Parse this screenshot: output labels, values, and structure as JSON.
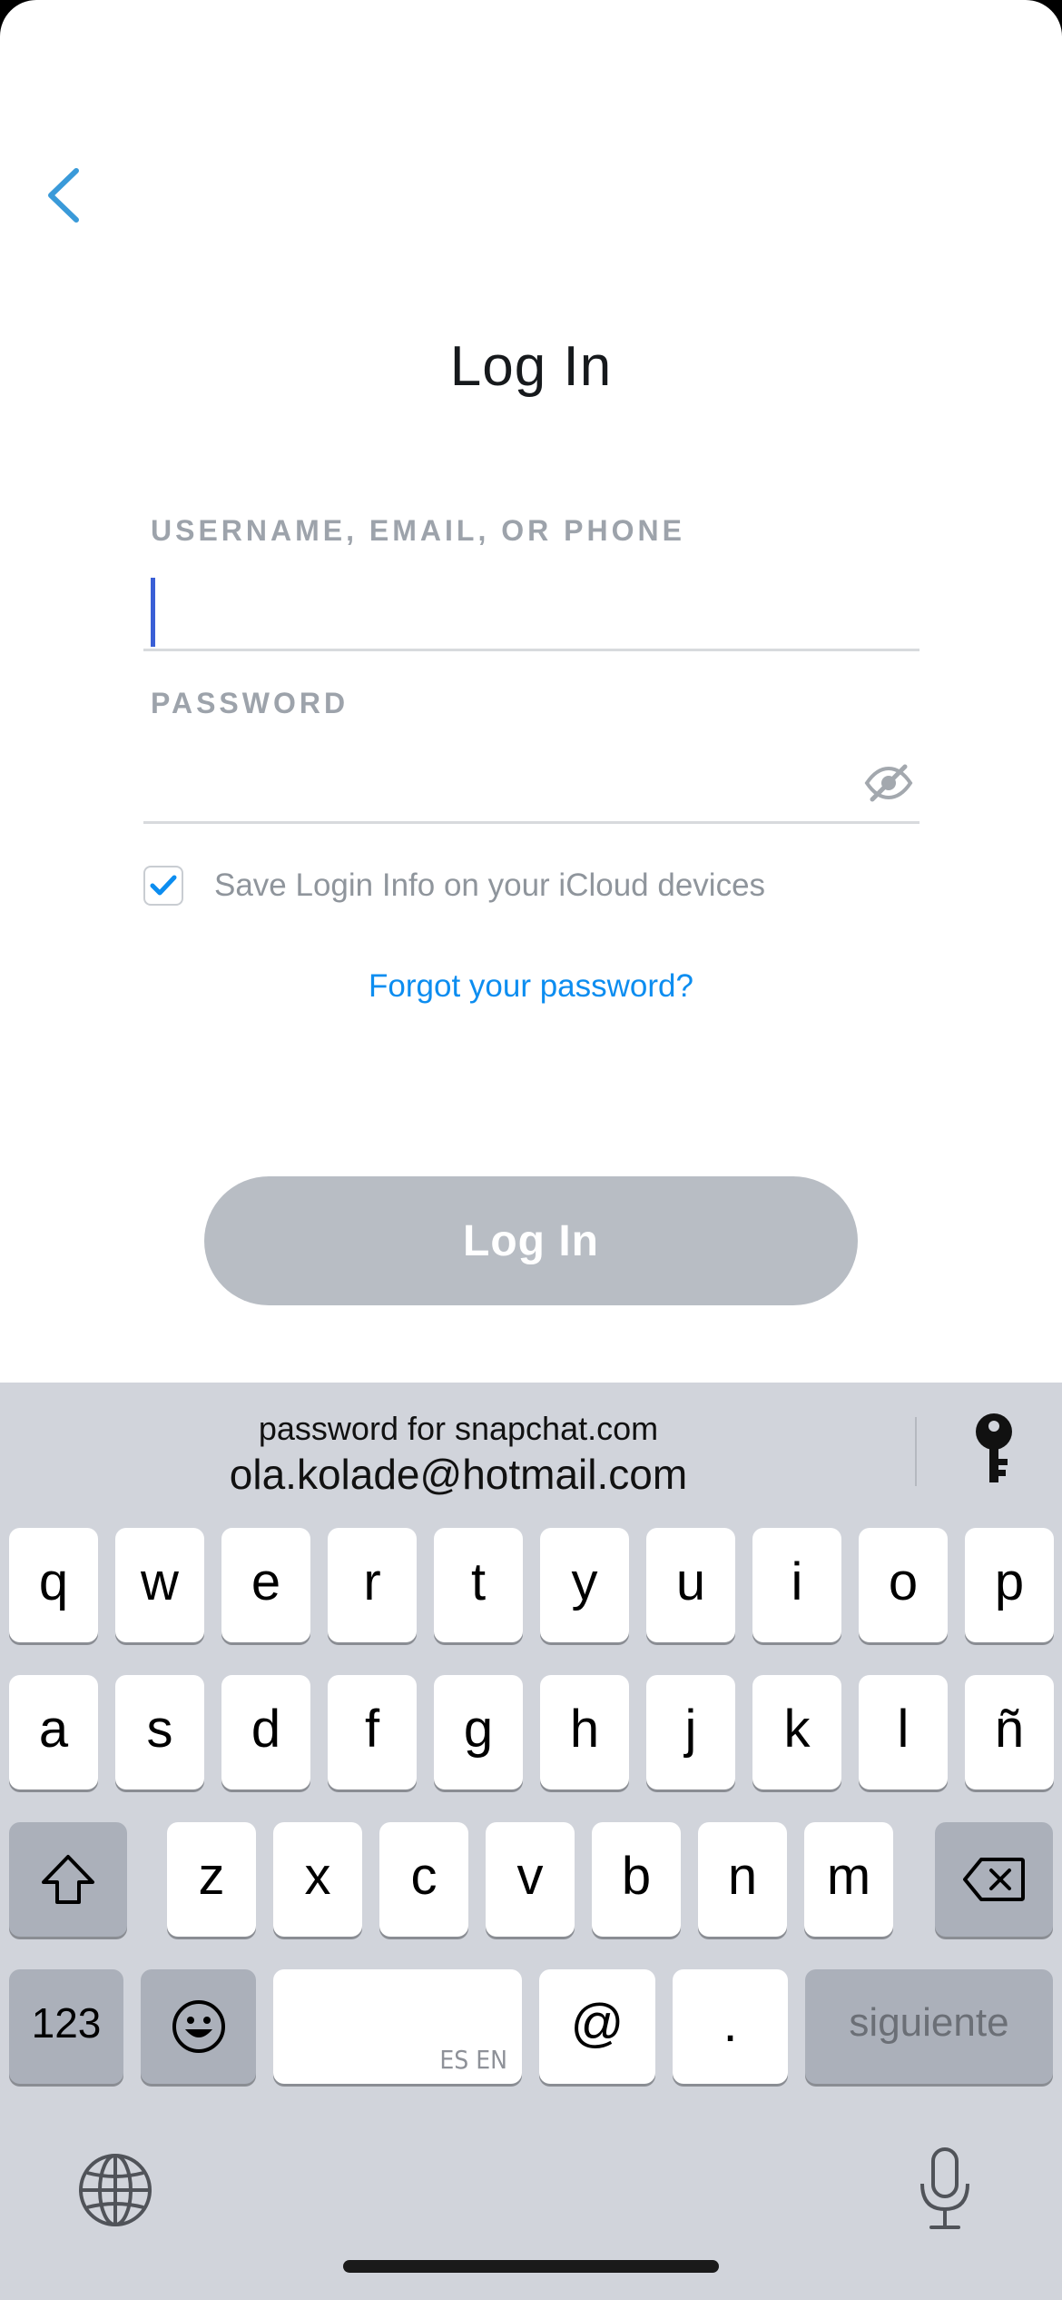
{
  "header": {
    "title": "Log In"
  },
  "form": {
    "username_label": "USERNAME, EMAIL, OR PHONE",
    "username_value": "",
    "password_label": "PASSWORD",
    "password_value": "",
    "save_login_label": "Save Login Info on your iCloud devices",
    "save_login_checked": true,
    "forgot_link": "Forgot your password?",
    "login_button": "Log In"
  },
  "keyboard": {
    "suggestion_subtitle": "password for snapchat.com",
    "suggestion_value": "ola.kolade@hotmail.com",
    "row1": [
      "q",
      "w",
      "e",
      "r",
      "t",
      "y",
      "u",
      "i",
      "o",
      "p"
    ],
    "row2": [
      "a",
      "s",
      "d",
      "f",
      "g",
      "h",
      "j",
      "k",
      "l",
      "ñ"
    ],
    "row3": [
      "z",
      "x",
      "c",
      "v",
      "b",
      "n",
      "m"
    ],
    "numbers_key": "123",
    "space_hint": "ES EN",
    "at_key": "@",
    "dot_key": ".",
    "next_key": "siguiente"
  },
  "colors": {
    "accent": "#0c8df0",
    "back_arrow": "#3a9ad9",
    "button_disabled": "#b8bdc4",
    "keyboard_bg": "#d1d4db"
  }
}
